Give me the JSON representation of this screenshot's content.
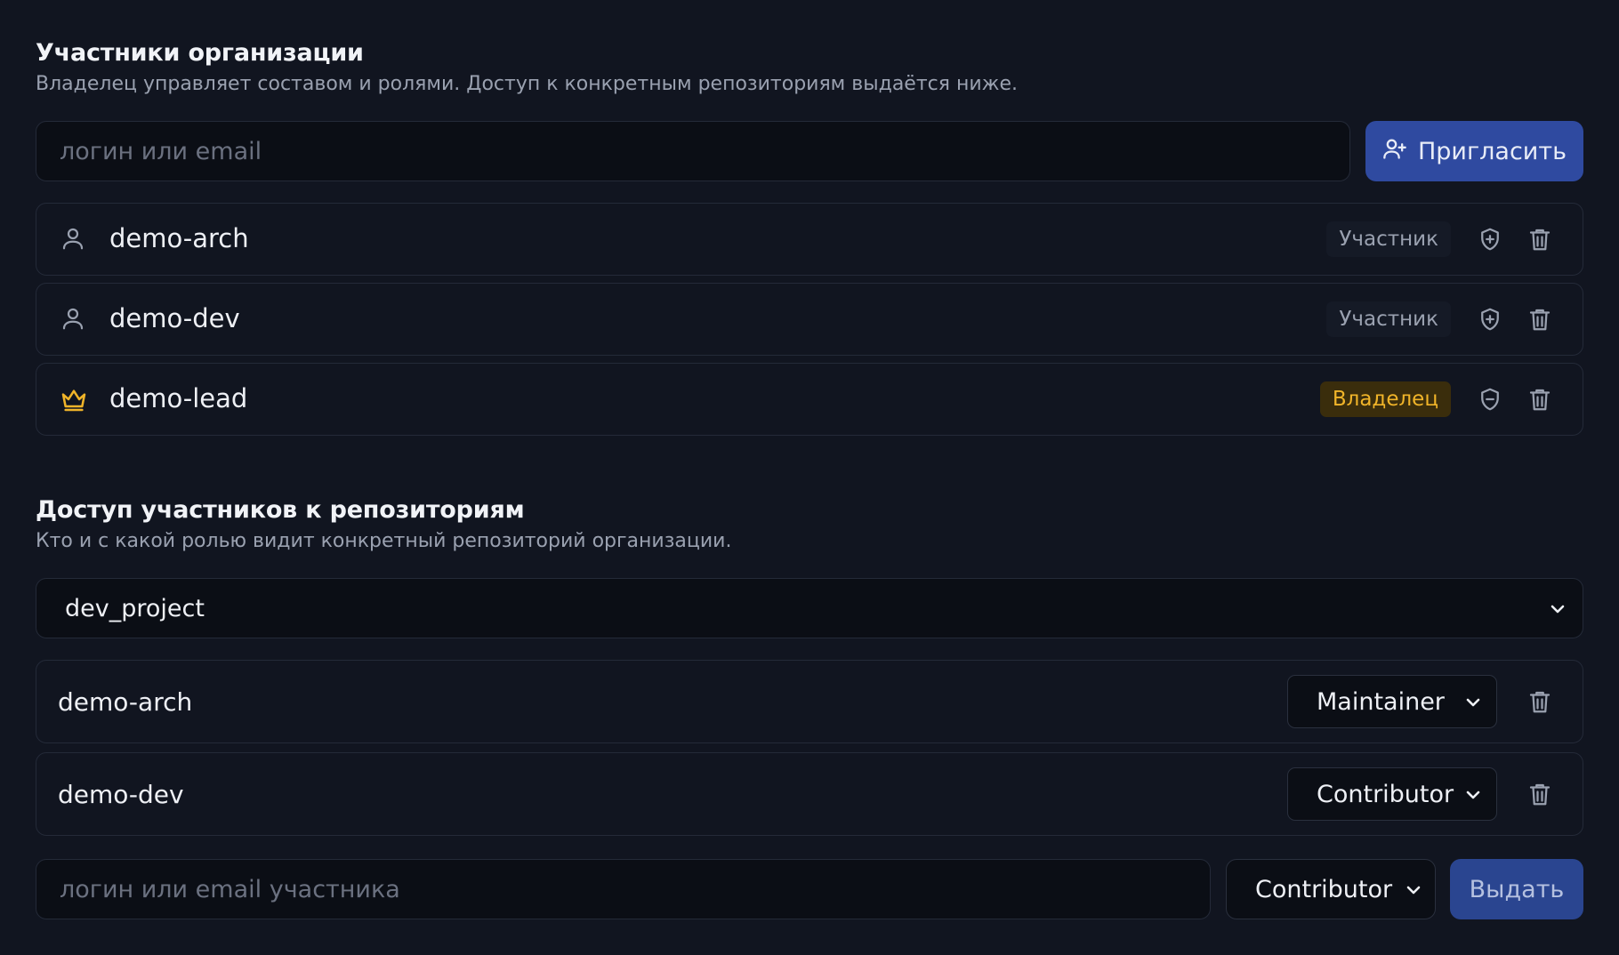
{
  "members": {
    "title": "Участники организации",
    "subtitle": "Владелец управляет составом и ролями. Доступ к конкретным репозиториям выдаётся ниже.",
    "invite_placeholder": "логин или email",
    "invite_button": "Пригласить",
    "rows": [
      {
        "name": "demo-arch",
        "role": "Участник",
        "icon": "user-icon",
        "role_action_icon": "shield-plus-icon"
      },
      {
        "name": "demo-dev",
        "role": "Участник",
        "icon": "user-icon",
        "role_action_icon": "shield-plus-icon"
      },
      {
        "name": "demo-lead",
        "role": "Владелец",
        "icon": "crown-icon",
        "role_action_icon": "shield-minus-icon"
      }
    ]
  },
  "repo_access": {
    "title": "Доступ участников к репозиториям",
    "subtitle": "Кто и с какой ролью видит конкретный репозиторий организации.",
    "selected_repo": "dev_project",
    "rows": [
      {
        "name": "demo-arch",
        "role": "Maintainer"
      },
      {
        "name": "demo-dev",
        "role": "Contributor"
      }
    ],
    "grant_placeholder": "логин или email участника",
    "grant_role": "Contributor",
    "grant_button": "Выдать"
  },
  "colors": {
    "background": "#111520",
    "accent": "#2f4aa0",
    "owner": "#f0b429"
  }
}
